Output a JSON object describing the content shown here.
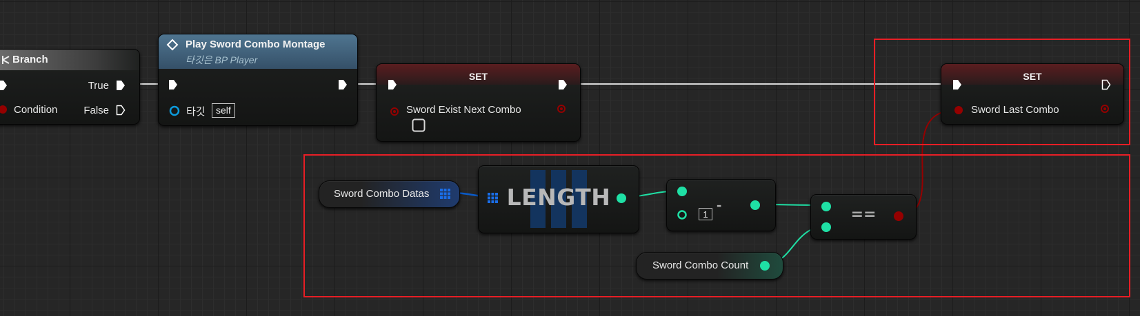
{
  "branch": {
    "title": "Branch",
    "true_label": "True",
    "condition_label": "Condition",
    "false_label": "False"
  },
  "montage": {
    "title": "Play Sword Combo Montage",
    "subtitle_prefix": "타깃은",
    "subtitle_target": "BP Player",
    "target_label": "타깃",
    "self_label": "self"
  },
  "set1": {
    "title": "SET",
    "var_label": "Sword Exist Next Combo"
  },
  "set2": {
    "title": "SET",
    "var_label": "Sword Last Combo"
  },
  "combo_datas": {
    "label": "Sword Combo Datas"
  },
  "length": {
    "label": "LENGTH"
  },
  "minus": {
    "op": "-",
    "literal": "1"
  },
  "equal": {
    "op": "=="
  },
  "combo_count": {
    "label": "Sword Combo Count"
  },
  "colors": {
    "exec": "#ffffff",
    "bool": "#950000",
    "int": "#1fe0a5",
    "array": "#0a5bc9",
    "object": "#0c9bdd",
    "highlight": "#e81e25"
  }
}
